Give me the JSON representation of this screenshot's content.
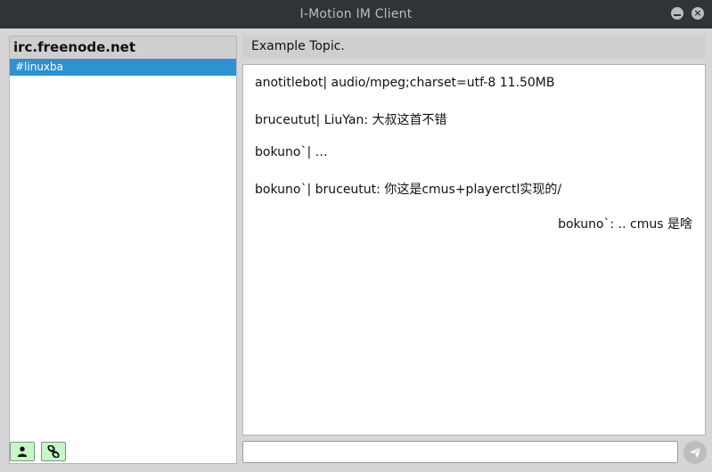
{
  "window": {
    "title": "I-Motion IM Client"
  },
  "sidebar": {
    "server": "irc.freenode.net",
    "channels": [
      {
        "label": "#linuxba",
        "selected": true
      }
    ],
    "buttons": [
      {
        "icon": "user-icon"
      },
      {
        "icon": "link-icon"
      }
    ]
  },
  "topic": "Example Topic.",
  "messages": [
    {
      "text": "anotitlebot| audio/mpeg;charset=utf-8 11.50MB",
      "align": "left"
    },
    {
      "text": "bruceutut| LiuYan: 大叔这首不错",
      "align": "left"
    },
    {
      "text": "bokuno`| …",
      "align": "left"
    },
    {
      "text": "bokuno`| bruceutut: 你这是cmus+playerctl实现的/",
      "align": "left"
    },
    {
      "text": "bokuno`: .. cmus 是啥",
      "align": "right"
    }
  ],
  "input": {
    "value": "",
    "placeholder": ""
  },
  "colors": {
    "titlebar": "#2f3437",
    "selection": "#2f91d0",
    "button_bg": "#c6f7c6",
    "panel": "#cfcfcf"
  }
}
